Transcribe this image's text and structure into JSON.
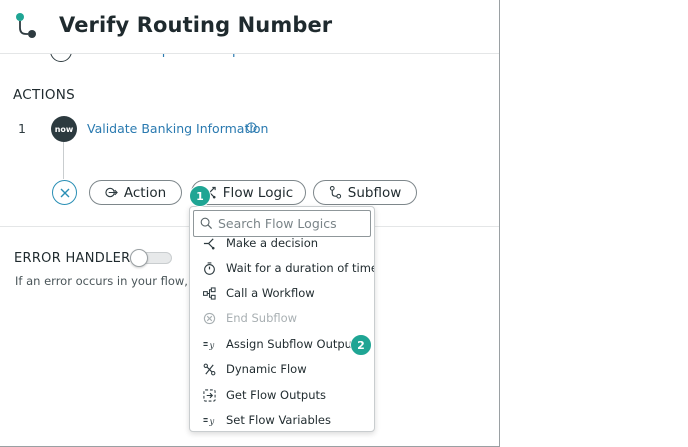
{
  "header": {
    "title": "Verify Routing Number"
  },
  "peek": {
    "label": "Subflow Inputs & Outputs"
  },
  "actions": {
    "section_label": "ACTIONS",
    "step": {
      "number": "1",
      "badge": "now",
      "label": "Validate Banking Information"
    }
  },
  "add_buttons": {
    "action": "Action",
    "flow_logic": "Flow Logic",
    "subflow": "Subflow"
  },
  "error_handler": {
    "label": "ERROR HANDLER",
    "enabled": false,
    "description": "If an error occurs in your flow, the"
  },
  "dropdown": {
    "search_placeholder": "Search Flow Logics",
    "items": [
      {
        "label": "Make a decision",
        "icon": "branch-icon",
        "disabled": false
      },
      {
        "label": "Wait for a duration of time",
        "icon": "timer-icon",
        "disabled": false
      },
      {
        "label": "Call a Workflow",
        "icon": "workflow-icon",
        "disabled": false
      },
      {
        "label": "End Subflow",
        "icon": "end-circle-icon",
        "disabled": true
      },
      {
        "label": "Assign Subflow Outputs",
        "icon": "assign-icon",
        "disabled": false
      },
      {
        "label": "Dynamic Flow",
        "icon": "dynamic-flow-icon",
        "disabled": false
      },
      {
        "label": "Get Flow Outputs",
        "icon": "get-outputs-icon",
        "disabled": false
      },
      {
        "label": "Set Flow Variables",
        "icon": "assign-icon",
        "disabled": false
      }
    ]
  },
  "callouts": {
    "first": "1",
    "second": "2"
  },
  "colors": {
    "accent": "#2a7ab0",
    "callout": "#1fa594",
    "badge": "#2c3a3f"
  }
}
